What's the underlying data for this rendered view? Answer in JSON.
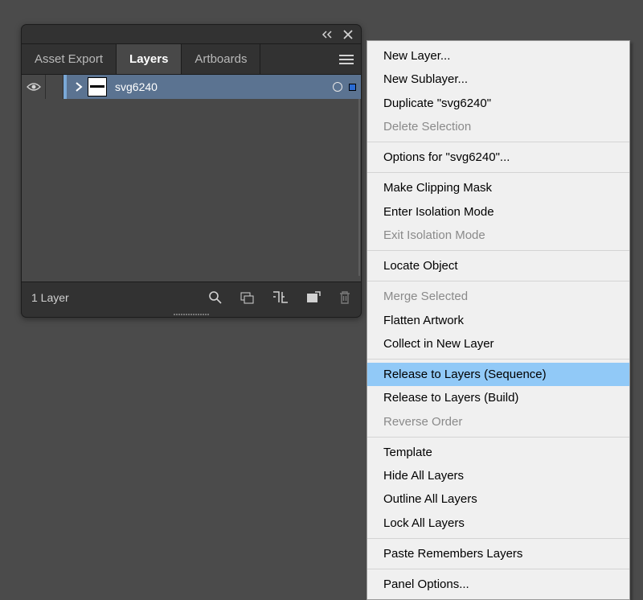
{
  "panel": {
    "tabs": [
      "Asset Export",
      "Layers",
      "Artboards"
    ],
    "activeTabIndex": 1,
    "layers": [
      {
        "name": "svg6240",
        "selected": true
      }
    ],
    "footerStatus": "1 Layer"
  },
  "icons": {
    "collapse": "collapse-icon",
    "close": "close-icon",
    "menu": "menu-icon",
    "eye": "eye-icon",
    "chevronRight": "chevron-right-icon",
    "search": "search-icon",
    "newSub": "new-sublayer-icon",
    "mask": "clipping-mask-icon",
    "newLayer": "new-layer-icon",
    "trash": "trash-icon"
  },
  "contextMenu": {
    "groups": [
      [
        {
          "label": "New Layer...",
          "enabled": true
        },
        {
          "label": "New Sublayer...",
          "enabled": true
        },
        {
          "label": "Duplicate \"svg6240\"",
          "enabled": true
        },
        {
          "label": "Delete Selection",
          "enabled": false
        }
      ],
      [
        {
          "label": "Options for \"svg6240\"...",
          "enabled": true
        }
      ],
      [
        {
          "label": "Make Clipping Mask",
          "enabled": true
        },
        {
          "label": "Enter Isolation Mode",
          "enabled": true
        },
        {
          "label": "Exit Isolation Mode",
          "enabled": false
        }
      ],
      [
        {
          "label": "Locate Object",
          "enabled": true
        }
      ],
      [
        {
          "label": "Merge Selected",
          "enabled": false
        },
        {
          "label": "Flatten Artwork",
          "enabled": true
        },
        {
          "label": "Collect in New Layer",
          "enabled": true
        }
      ],
      [
        {
          "label": "Release to Layers (Sequence)",
          "enabled": true,
          "highlighted": true
        },
        {
          "label": "Release to Layers (Build)",
          "enabled": true
        },
        {
          "label": "Reverse Order",
          "enabled": false
        }
      ],
      [
        {
          "label": "Template",
          "enabled": true
        },
        {
          "label": "Hide All Layers",
          "enabled": true
        },
        {
          "label": "Outline All Layers",
          "enabled": true
        },
        {
          "label": "Lock All Layers",
          "enabled": true
        }
      ],
      [
        {
          "label": "Paste Remembers Layers",
          "enabled": true
        }
      ],
      [
        {
          "label": "Panel Options...",
          "enabled": true
        }
      ]
    ]
  }
}
